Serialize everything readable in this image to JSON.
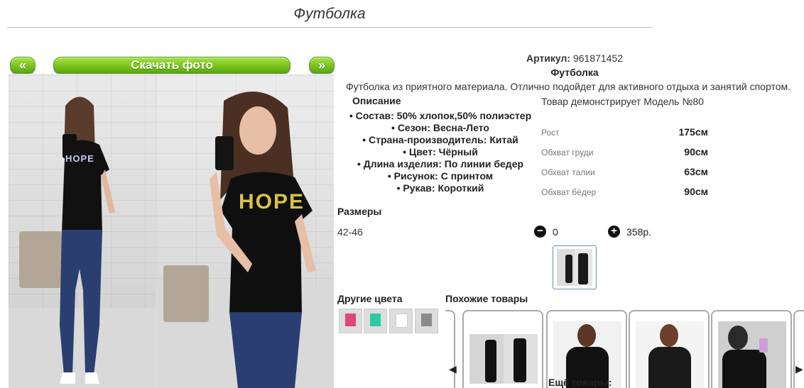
{
  "header": {
    "title": "Футболка"
  },
  "gallery": {
    "prev_label": "«",
    "next_label": "»",
    "download_label": "Скачать фото",
    "shirt_print": "HOPE"
  },
  "product": {
    "article_label": "Артикул:",
    "article_value": "961871452",
    "name": "Футболка",
    "description": "Футболка из приятного материала. Отлично подойдет для активного отдыха и занятий спортом.",
    "description_heading": "Описание",
    "specs": [
      "• Состав: 50% хлопок,50% полиэстер",
      "• Сезон: Весна-Лето",
      "• Страна-производитель: Китай",
      "• Цвет: Чёрный",
      "• Длина изделия: По линии бедер",
      "• Рисунок: С принтом",
      "• Рукав: Короткий"
    ]
  },
  "model": {
    "title": "Товар демонстрирует Модель №80",
    "measurements": [
      {
        "label": "Рост",
        "value": "175см"
      },
      {
        "label": "Обхват груди",
        "value": "90см"
      },
      {
        "label": "Обхват талии",
        "value": "63см"
      },
      {
        "label": "Обхват бёдер",
        "value": "90см"
      }
    ]
  },
  "sizes": {
    "heading": "Размеры",
    "row": {
      "size": "42-46",
      "minus_label": "−",
      "quantity": "0",
      "plus_label": "+",
      "price": "358р."
    }
  },
  "other_colors": {
    "heading": "Другие цвета",
    "swatches": [
      "#e0457b",
      "#2ec9a0",
      "#ffffff",
      "#111111",
      "#8a8a8a"
    ]
  },
  "similar": {
    "heading": "Похожие товары",
    "more_label": "Ещё товары:",
    "arrow_left": "◀",
    "arrow_right": "▶"
  },
  "colors": {
    "accent_green": "#7cc61e",
    "thumb_border": "#6a8fb5"
  }
}
